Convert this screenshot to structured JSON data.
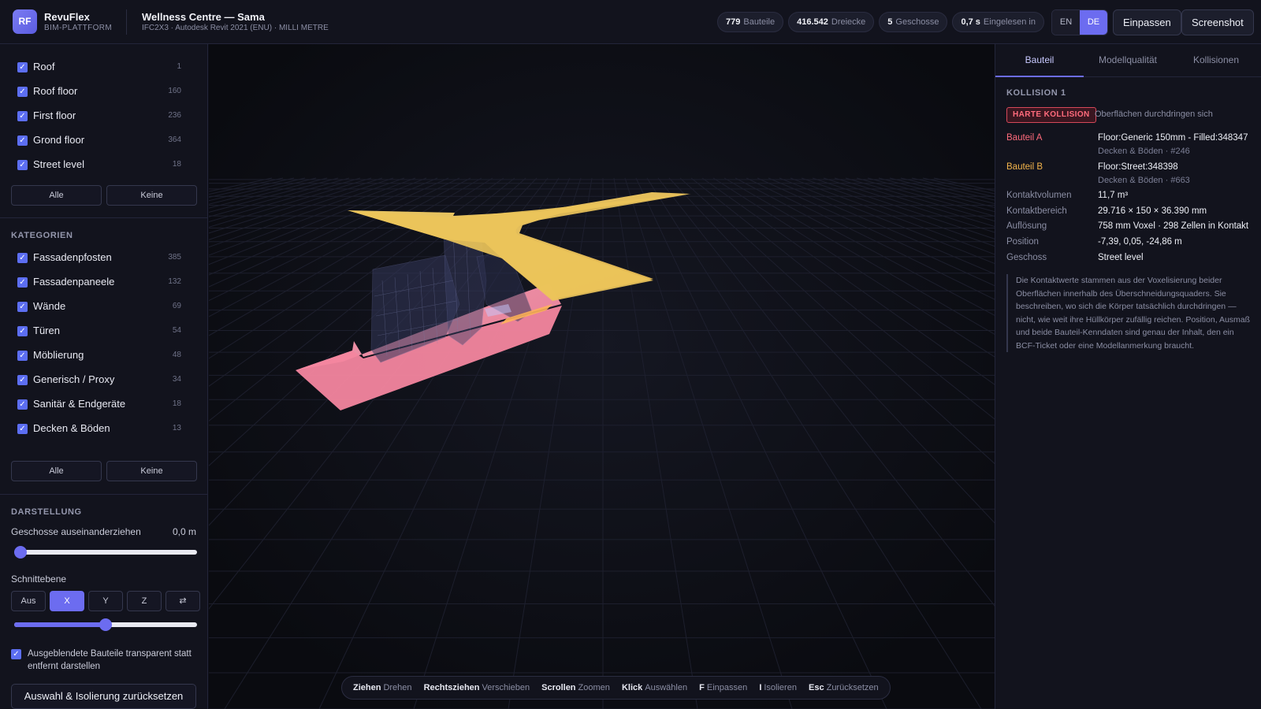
{
  "header": {
    "logo_text": "RF",
    "brand_name": "RevuFlex",
    "brand_sub": "BIM-PLATTFORM",
    "project_title": "Wellness Centre — Sama",
    "project_sub": "IFC2X3 · Autodesk Revit 2021 (ENU) · MILLI METRE",
    "stats": [
      {
        "value": "779",
        "label": "Bauteile"
      },
      {
        "value": "416.542",
        "label": "Dreiecke"
      },
      {
        "value": "5",
        "label": "Geschosse"
      },
      {
        "value": "0,7 s",
        "label": "Eingelesen in"
      }
    ],
    "lang_en": "EN",
    "lang_de": "DE",
    "fit_label": "Einpassen",
    "screenshot_label": "Screenshot"
  },
  "storeys": {
    "items": [
      {
        "label": "Roof",
        "count": "1"
      },
      {
        "label": "Roof floor",
        "count": "160"
      },
      {
        "label": "First floor",
        "count": "236"
      },
      {
        "label": "Grond floor",
        "count": "364"
      },
      {
        "label": "Street level",
        "count": "18"
      }
    ],
    "all_label": "Alle",
    "none_label": "Keine"
  },
  "categories": {
    "heading": "KATEGORIEN",
    "items": [
      {
        "label": "Fassadenpfosten",
        "count": "385"
      },
      {
        "label": "Fassadenpaneele",
        "count": "132"
      },
      {
        "label": "Wände",
        "count": "69"
      },
      {
        "label": "Türen",
        "count": "54"
      },
      {
        "label": "Möblierung",
        "count": "48"
      },
      {
        "label": "Generisch / Proxy",
        "count": "34"
      },
      {
        "label": "Sanitär & Endgeräte",
        "count": "18"
      },
      {
        "label": "Decken & Böden",
        "count": "13"
      }
    ],
    "all_label": "Alle",
    "none_label": "Keine"
  },
  "display": {
    "heading": "DARSTELLUNG",
    "explode_label": "Geschosse auseinanderziehen",
    "explode_value": "0,0 m",
    "explode_fraction": 0.0,
    "section_label": "Schnittebene",
    "section_options": [
      "Aus",
      "X",
      "Y",
      "Z",
      "⇄"
    ],
    "section_selected": "X",
    "section_fraction": 0.5,
    "transparent_label": "Ausgeblendete Bauteile transparent statt entfernt darstellen",
    "reset_label": "Auswahl & Isolierung zurücksetzen"
  },
  "hints": [
    {
      "key": "Ziehen",
      "action": "Drehen"
    },
    {
      "key": "Rechtsziehen",
      "action": "Verschieben"
    },
    {
      "key": "Scrollen",
      "action": "Zoomen"
    },
    {
      "key": "Klick",
      "action": "Auswählen"
    },
    {
      "key": "F",
      "action": "Einpassen"
    },
    {
      "key": "I",
      "action": "Isolieren"
    },
    {
      "key": "Esc",
      "action": "Zurücksetzen"
    }
  ],
  "panel": {
    "tabs": [
      "Bauteil",
      "Modellqualität",
      "Kollisionen"
    ],
    "collision_title": "KOLLISION 1",
    "badge": "HARTE KOLLISION",
    "badge_desc": "Oberflächen durchdringen sich",
    "part_a_key": "Bauteil A",
    "part_a_name": "Floor:Generic 150mm - Filled:348347",
    "part_a_sub": "Decken & Böden · #246",
    "part_b_key": "Bauteil B",
    "part_b_name": "Floor:Street:348398",
    "part_b_sub": "Decken & Böden · #663",
    "rows": [
      {
        "key": "Kontaktvolumen",
        "value": "11,7 m³"
      },
      {
        "key": "Kontaktbereich",
        "value": "29.716 × 150 × 36.390 mm"
      },
      {
        "key": "Auflösung",
        "value": "758 mm Voxel · 298 Zellen in Kontakt"
      },
      {
        "key": "Position",
        "value": "-7,39, 0,05, -24,86 m"
      },
      {
        "key": "Geschoss",
        "value": "Street level"
      }
    ],
    "note": "Die Kontaktwerte stammen aus der Voxelisierung beider Oberflächen innerhalb des Überschneidungsquaders. Sie beschreiben, wo sich die Körper tatsächlich durchdringen — nicht, wie weit ihre Hüllkörper zufällig reichen. Position, Ausmaß und beide Bauteil-Kenndaten sind genau der Inhalt, den ein BCF-Ticket oder eine Modellanmerkung braucht."
  },
  "colors": {
    "accent": "#6c6cf0",
    "part_a": "#ff6b7c",
    "part_b": "#f3b44b",
    "slab_pink": "#f4869f",
    "slab_yellow": "#ecc45a"
  }
}
